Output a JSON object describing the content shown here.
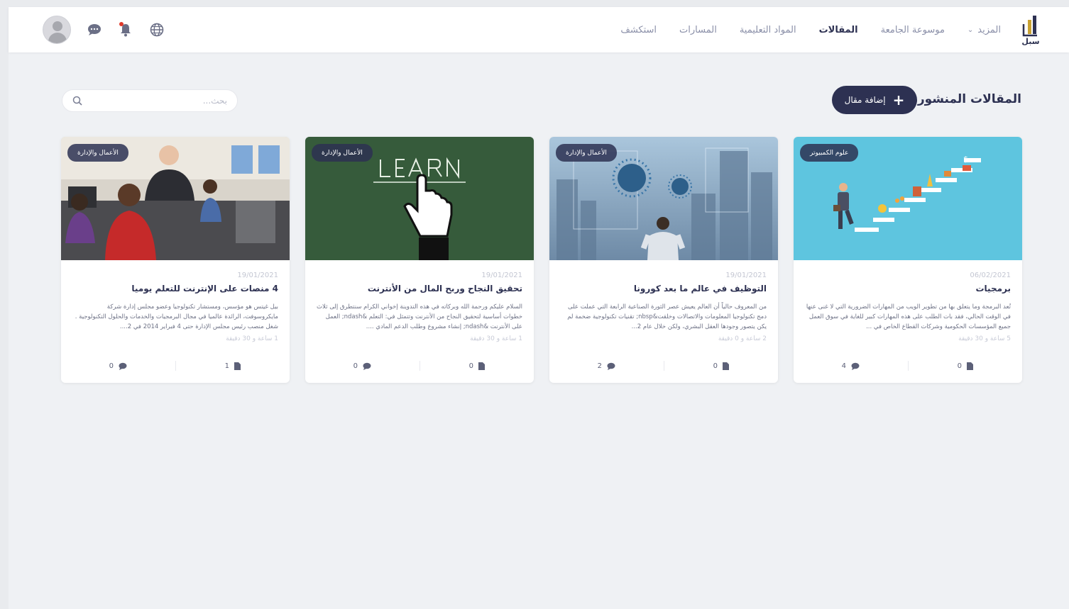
{
  "brand": {
    "logo_text": "سبل"
  },
  "nav": {
    "items": [
      {
        "label": "استكشف",
        "active": false
      },
      {
        "label": "المسارات",
        "active": false
      },
      {
        "label": "المواد التعليمية",
        "active": false
      },
      {
        "label": "المقالات",
        "active": true
      },
      {
        "label": "موسوعة الجامعة",
        "active": false
      },
      {
        "label": "المزيد",
        "active": false,
        "dropdown": true
      }
    ]
  },
  "header_icons": [
    "globe-icon",
    "bell-icon",
    "chat-icon",
    "user-avatar"
  ],
  "page": {
    "title": "المقالات المنشورة",
    "add_button": "إضافة مقال",
    "search_placeholder": "بحث..."
  },
  "colors": {
    "primary": "#2d3152",
    "background": "#eff1f4",
    "notification_dot": "#e0392b"
  },
  "articles": [
    {
      "badge": "علوم الكمبيوتر",
      "date": "06/02/2021",
      "title": "برمجيات",
      "excerpt": "تُعد البرمجة وما يتعلق بها من تطوير الويب من المهارات الضرورية التي لا غنى عنها في الوقت الحالي، فقد بات الطلب على هذه المهارات كبير للغاية في سوق العمل جميع المؤسسات الحكومية وشركات القطاع الخاص في ...",
      "read_time": "5 ساعة و 30 دقيقة",
      "comments": "4",
      "files": "0"
    },
    {
      "badge": "الأعمال والإدارة",
      "date": "19/01/2021",
      "title": "التوظيف في عالم ما بعد كورونا",
      "excerpt": "من المعروف حالياً أن العالم يعيش عصر الثورة الصناعية الرابعة التي عملت على دمج تكنولوجيا المعلومات والاتصالات وخلقت&nbsp; تقنيات تكنولوجية ضخمة لم يكن يتصور وجودها العقل البشري، ولكن خلال عام 2...",
      "read_time": "2 ساعة و 0 دقيقة",
      "comments": "2",
      "files": "0"
    },
    {
      "badge": "الأعمال والإدارة",
      "date": "19/01/2021",
      "title": "تحقيق النجاح وربح المال من الأنترنت",
      "excerpt": "السلام عليكم ورحمة الله وبركاته في هذه التدوينة إخواني الكرام سنتطرق إلى ثلاث خطوات أساسية لتحقيق النجاح من الأنترنت وتتمثل في: التعلم &ndash; العمل على الأنترنت &ndash; إنشاء مشروع وطلب الدعم المادي ....",
      "read_time": "1 ساعة و 30 دقيقة",
      "comments": "0",
      "files": "0"
    },
    {
      "badge": "الأعمال والإدارة",
      "date": "19/01/2021",
      "title": "4 منصات على الإنترنت للتعلم يوميا",
      "excerpt": "بيل غيتس هو مؤسس، ومستشار تكنولوجيا وعضو مجلس إدارة شركة مايكروسوفت، الرائدة عالميا في مجال البرمجيات والخدمات والحلول التكنولوجية . شغل منصب رئيس مجلس الإدارة حتى 4 فبراير 2014 في 2....",
      "read_time": "1 ساعة و 30 دقيقة",
      "comments": "0",
      "files": "1"
    }
  ]
}
